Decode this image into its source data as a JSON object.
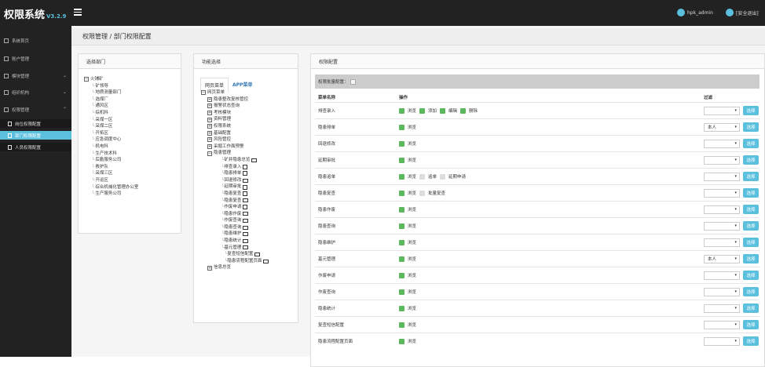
{
  "header": {
    "brand": "权限系统",
    "version": "V3.2.9",
    "user": "hpk_admin",
    "logout": "[安全退出]"
  },
  "sidebar": {
    "items": [
      {
        "label": "系统首页"
      },
      {
        "label": "账户管理"
      },
      {
        "label": "模块管理"
      },
      {
        "label": "组织机构"
      },
      {
        "label": "权限管理"
      }
    ],
    "sub": [
      {
        "label": "岗位权限配置"
      },
      {
        "label": "部门权限配置"
      },
      {
        "label": "人员权限配置"
      }
    ]
  },
  "breadcrumb": "权限管理 / 部门权限配置",
  "dept_panel": {
    "title": "选择部门",
    "root": "火铺矿",
    "items": [
      "矿领导",
      "地质测量部门",
      "选煤厂",
      "通风区",
      "综机科",
      "采煤一区",
      "采煤二区",
      "开拓区",
      "应急调度中心",
      "机电科",
      "生产技术科",
      "后勤服务公司",
      "救护队",
      "采煤三区",
      "开运区",
      "综合机械化管理办公室",
      "生产服务公司"
    ]
  },
  "func_panel": {
    "title": "功能选择",
    "tab_web": "网页菜单",
    "tab_app": "APP菜单",
    "root": "网页菜单",
    "groups": [
      "隐患整改复核管控",
      "报警状态查询",
      "考核模块",
      "资料管理",
      "权限系统",
      "基础配置",
      "风险管控",
      "采掘工作面预警",
      "隐患管理"
    ],
    "hazard_items": [
      "矿井隐患总览",
      "排查录入",
      "隐患排单",
      "回退修改",
      "延期审批",
      "隐患复查",
      "隐患复查",
      "作废申请",
      "隐患作废",
      "作废查询",
      "隐患查询",
      "隐患维护",
      "隐患统计",
      "基元管理",
      "复查短信配置",
      "隐患流程配置页面"
    ],
    "last": "信息总览"
  },
  "perm_panel": {
    "title": "权限配置",
    "batch_label": "权限批量配置：",
    "col_name": "菜单名称",
    "col_ops": "操作",
    "col_filter": "过滤",
    "pick_label": "选择",
    "rows": [
      {
        "name": "排查录入",
        "ops": [
          {
            "t": "浏览",
            "on": true
          },
          {
            "t": "添加",
            "on": true
          },
          {
            "t": "编辑",
            "on": true
          },
          {
            "t": "删除",
            "on": true
          }
        ],
        "filter": ""
      },
      {
        "name": "隐患排单",
        "ops": [
          {
            "t": "浏览",
            "on": true
          }
        ],
        "filter": "本人"
      },
      {
        "name": "回退修改",
        "ops": [
          {
            "t": "浏览",
            "on": true
          }
        ],
        "filter": ""
      },
      {
        "name": "延期审批",
        "ops": [
          {
            "t": "浏览",
            "on": true
          }
        ],
        "filter": ""
      },
      {
        "name": "隐患追单",
        "ops": [
          {
            "t": "浏览",
            "on": true
          },
          {
            "t": "追单",
            "on": false
          },
          {
            "t": "延期申请",
            "on": false
          }
        ],
        "filter": ""
      },
      {
        "name": "隐患复查",
        "ops": [
          {
            "t": "浏览",
            "on": true
          },
          {
            "t": "批量复查",
            "on": false
          }
        ],
        "filter": ""
      },
      {
        "name": "隐患作废",
        "ops": [
          {
            "t": "浏览",
            "on": true
          }
        ],
        "filter": ""
      },
      {
        "name": "隐患查询",
        "ops": [
          {
            "t": "浏览",
            "on": true
          }
        ],
        "filter": ""
      },
      {
        "name": "隐患维护",
        "ops": [
          {
            "t": "浏览",
            "on": true
          }
        ],
        "filter": ""
      },
      {
        "name": "基元管理",
        "ops": [
          {
            "t": "浏览",
            "on": true
          }
        ],
        "filter": "本人"
      },
      {
        "name": "作废申请",
        "ops": [
          {
            "t": "浏览",
            "on": true
          }
        ],
        "filter": ""
      },
      {
        "name": "作废查询",
        "ops": [
          {
            "t": "浏览",
            "on": true
          }
        ],
        "filter": ""
      },
      {
        "name": "隐患统计",
        "ops": [
          {
            "t": "浏览",
            "on": true
          }
        ],
        "filter": ""
      },
      {
        "name": "复查短信配置",
        "ops": [
          {
            "t": "浏览",
            "on": true
          }
        ],
        "filter": ""
      },
      {
        "name": "隐患流程配置页面",
        "ops": [
          {
            "t": "浏览",
            "on": true
          }
        ],
        "filter": ""
      }
    ]
  },
  "colors": {
    "accent": "#5bc0de",
    "green": "#5cb85c",
    "dark": "#222222"
  }
}
